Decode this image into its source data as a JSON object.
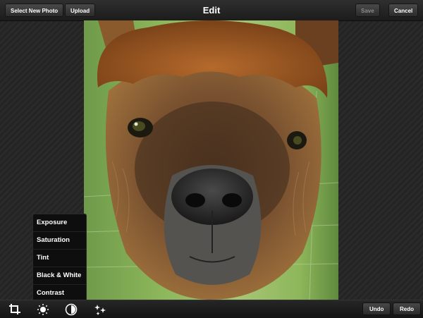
{
  "header": {
    "select_new_photo_label": "Select New Photo",
    "upload_label": "Upload",
    "title": "Edit",
    "save_label": "Save",
    "cancel_label": "Cancel"
  },
  "adjust_menu": {
    "items": [
      {
        "label": "Exposure"
      },
      {
        "label": "Saturation"
      },
      {
        "label": "Tint"
      },
      {
        "label": "Black & White"
      },
      {
        "label": "Contrast"
      }
    ]
  },
  "toolbar": {
    "tools": [
      "crop-icon",
      "brightness-icon",
      "adjust-icon",
      "effects-icon"
    ],
    "undo_label": "Undo",
    "redo_label": "Redo"
  },
  "colors": {
    "bar_background": "#1c1c1c",
    "menu_background": "#0e0e0e",
    "alpaca_fur": "#9a5c26"
  }
}
